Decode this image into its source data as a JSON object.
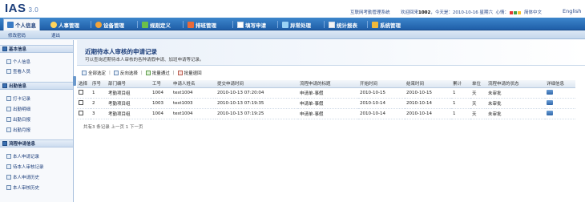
{
  "app": {
    "logo": "IAS",
    "version": "3.0"
  },
  "header": {
    "system_title": "互联网考勤管理系统",
    "welcome": "欢迎回来",
    "user_id": "1002",
    "today": "，今天是：2010-10-16 星期六",
    "mood_label": "心情：",
    "lang_cn": "简体中文",
    "lang_en": "English"
  },
  "nav": [
    {
      "label": "个人信息"
    },
    {
      "label": "人事管理"
    },
    {
      "label": "设备管理"
    },
    {
      "label": "规则定义"
    },
    {
      "label": "排班管理"
    },
    {
      "label": "填写申请"
    },
    {
      "label": "异常处理"
    },
    {
      "label": "统计报表"
    },
    {
      "label": "系统管理"
    }
  ],
  "subnav": [
    {
      "label": "修改密码"
    },
    {
      "label": "退出"
    }
  ],
  "sidebar": {
    "sections": [
      {
        "title": "基本信息",
        "items": [
          "个人信息",
          "查看人员"
        ]
      },
      {
        "title": "出勤信息",
        "items": [
          "打卡记录",
          "出勤明细",
          "出勤日报",
          "出勤月报"
        ]
      },
      {
        "title": "流程申请信息",
        "items": [
          "本人申请记录",
          "待本人审核记录",
          "本人申请历史",
          "本人审核历史"
        ]
      }
    ]
  },
  "page": {
    "title": "近期待本人审核的申请记录",
    "desc": "可以查询近期待本人审核的各种请假申请、加班申请等记录。"
  },
  "toolbar": {
    "select_all": "全部选定",
    "invert": "反向选择",
    "approve": "批量通过",
    "reject": "批量退回"
  },
  "table": {
    "headers": [
      "选择",
      "序号",
      "部门编号",
      "工号",
      "申请人姓名",
      "提交申请时间",
      "流程申请的标题",
      "开始时间",
      "结束时间",
      "累计",
      "单位",
      "流程申请的状态",
      "详细信息"
    ],
    "rows": [
      [
        "1",
        "考勤项目组",
        "1004",
        "test1004",
        "2010-10-13 07:20:04",
        "申请单-事假",
        "2010-10-15",
        "2010-10-15",
        "1",
        "天",
        "未审批"
      ],
      [
        "2",
        "考勤项目组",
        "1003",
        "test1003",
        "2010-10-13 07:19:35",
        "申请单-事假",
        "2010-10-14",
        "2010-10-14",
        "1",
        "天",
        "未审批"
      ],
      [
        "3",
        "考勤项目组",
        "1004",
        "test1004",
        "2010-10-13 07:19:25",
        "申请单-事假",
        "2010-10-14",
        "2010-10-14",
        "1",
        "天",
        "未审批"
      ]
    ]
  },
  "pager": {
    "text": "共有3 条记录 上一页 1 下一页"
  },
  "colors": {
    "nav": "#2a6fbe",
    "accent": "#1b3d7a",
    "mood": [
      "#e53935",
      "#43a047",
      "#fbc02d"
    ]
  }
}
